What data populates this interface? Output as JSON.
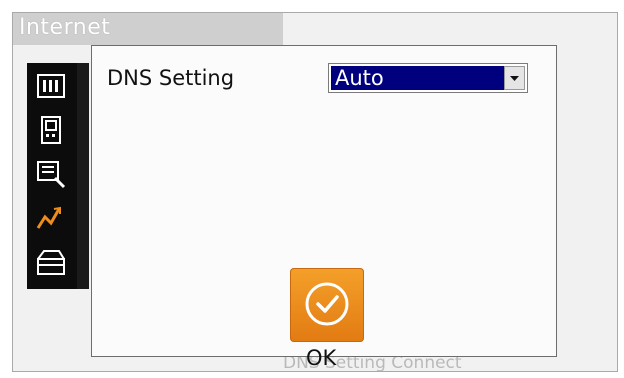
{
  "background": {
    "title": "Internet",
    "caption": "DNS Setting Connect",
    "toolbar_icons": [
      "calc-icon",
      "device-icon",
      "notes-search-icon",
      "chart-icon",
      "toolbox-icon"
    ]
  },
  "dialog": {
    "dns_label": "DNS Setting",
    "dns_value": "Auto",
    "ok_label": "OK"
  },
  "colors": {
    "accent_orange": "#ee8c1c",
    "selection_blue": "#00007f"
  }
}
